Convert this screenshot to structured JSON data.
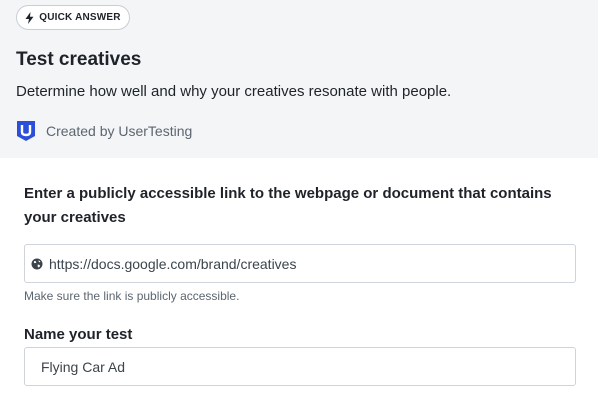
{
  "header": {
    "badge": {
      "icon": "lightning-bolt-icon",
      "label": "QUICK ANSWER"
    },
    "title": "Test creatives",
    "subtitle": "Determine how well and why your creatives resonate with people.",
    "creator": {
      "logo": "usertesting-logo-icon",
      "label": "Created by UserTesting",
      "logo_color": "#2b4fd8"
    }
  },
  "form": {
    "link_question": "Enter a publicly accessible link to the webpage or document that contains your creatives",
    "link_input": {
      "icon": "globe-icon",
      "value": "https://docs.google.com/brand/creatives"
    },
    "link_helper": "Make sure the link is publicly accessible.",
    "name_label": "Name your test",
    "name_input": {
      "value": "Flying Car Ad"
    }
  }
}
